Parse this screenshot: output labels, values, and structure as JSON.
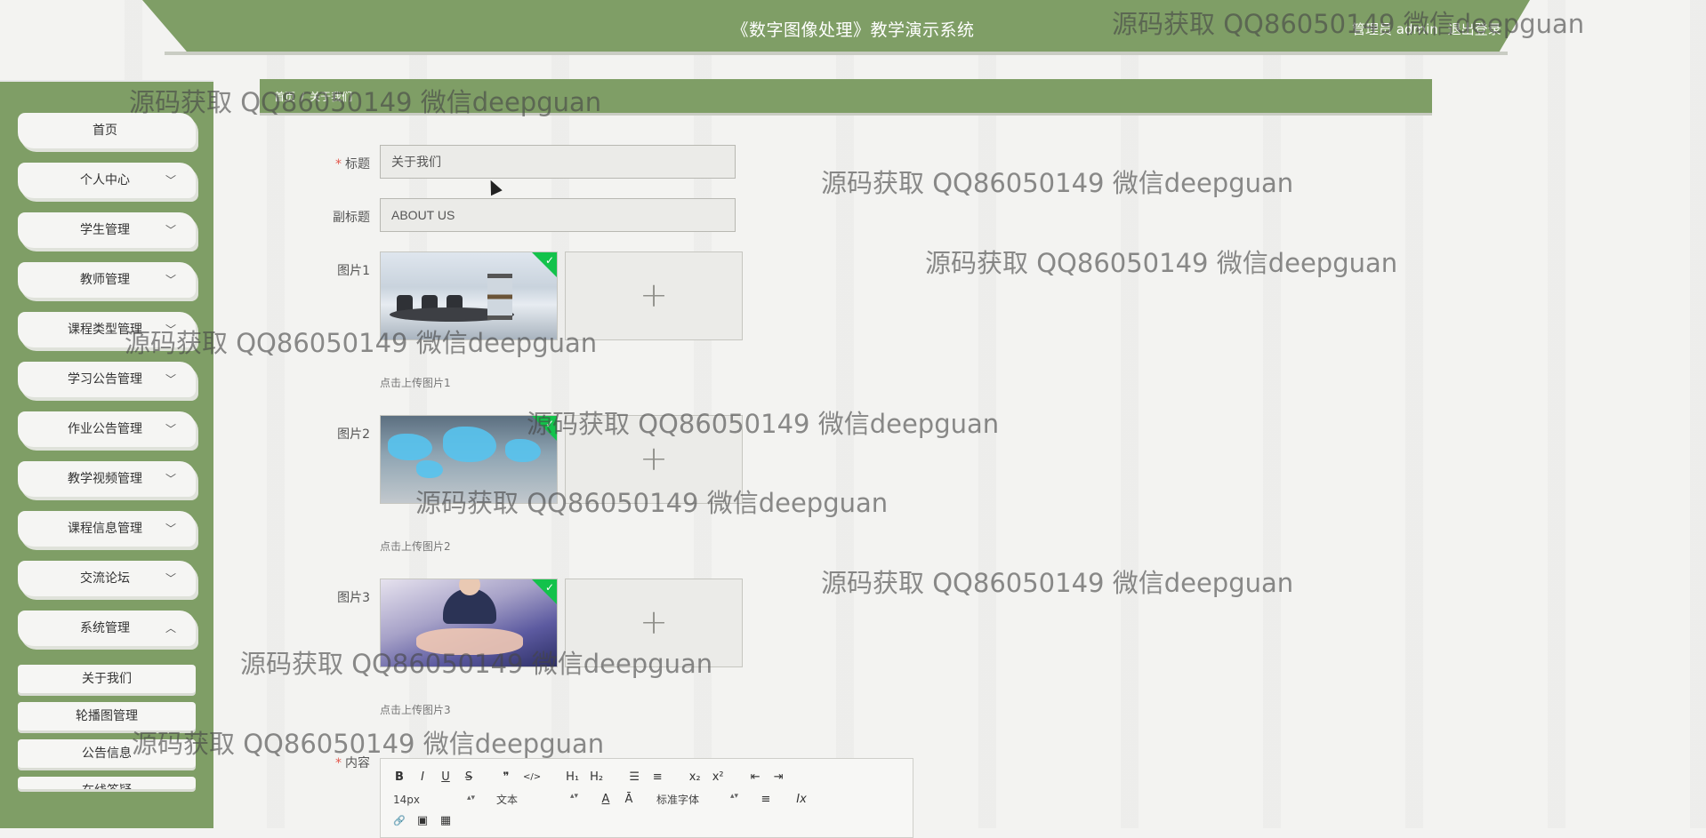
{
  "header": {
    "title": "《数字图像处理》教学演示系统",
    "user_label": "管理员 admin",
    "logout_label": "退出登录"
  },
  "sidebar": {
    "items": [
      {
        "label": "首页",
        "chevron": ""
      },
      {
        "label": "个人中心",
        "chevron": "﹀"
      },
      {
        "label": "学生管理",
        "chevron": "﹀"
      },
      {
        "label": "教师管理",
        "chevron": "﹀"
      },
      {
        "label": "课程类型管理",
        "chevron": "﹀"
      },
      {
        "label": "学习公告管理",
        "chevron": "﹀"
      },
      {
        "label": "作业公告管理",
        "chevron": "﹀"
      },
      {
        "label": "教学视频管理",
        "chevron": "﹀"
      },
      {
        "label": "课程信息管理",
        "chevron": "﹀"
      },
      {
        "label": "交流论坛",
        "chevron": "﹀"
      },
      {
        "label": "系统管理",
        "chevron": "︿"
      }
    ],
    "sub_items": [
      {
        "label": "关于我们"
      },
      {
        "label": "轮播图管理"
      },
      {
        "label": "公告信息"
      },
      {
        "label": "在线答疑"
      }
    ]
  },
  "breadcrumb": {
    "home": "首页",
    "separator": "/",
    "current": "关于我们"
  },
  "form": {
    "title_label": "标题",
    "title_value": "关于我们",
    "subtitle_label": "副标题",
    "subtitle_value": "ABOUT US",
    "pic1_label": "图片1",
    "pic1_tip": "点击上传图片1",
    "pic2_label": "图片2",
    "pic2_tip": "点击上传图片2",
    "pic3_label": "图片3",
    "pic3_tip": "点击上传图片3",
    "content_label": "内容",
    "upload_plus": "+",
    "required_mark": "*"
  },
  "editor": {
    "row1": [
      "B",
      "I",
      "U",
      "S",
      "❞",
      "</>",
      "H₁",
      "H₂",
      "☰",
      "≡",
      "x₂",
      "x²",
      "⇤",
      "⇥"
    ],
    "size_select": "14px",
    "text_select": "文本",
    "font_select": "标准字体",
    "row2_icons": [
      "A",
      "Ā",
      "≡",
      "Ix"
    ],
    "row3_icons": [
      "🔗",
      "▣",
      "▦"
    ]
  },
  "watermark": "源码获取 QQ86050149 微信deepguan",
  "colors": {
    "primary": "#7f9e66",
    "required": "#e2574c",
    "badge_green": "#13c24b"
  }
}
